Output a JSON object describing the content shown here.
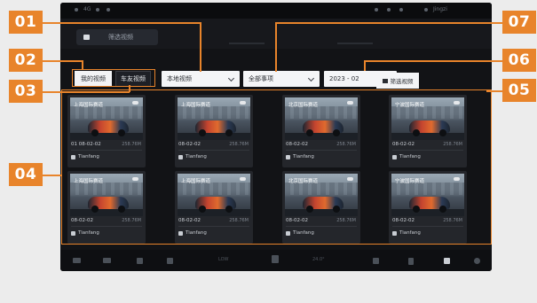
{
  "callouts": {
    "c01": "01",
    "c02": "02",
    "c03": "03",
    "c04": "04",
    "c05": "05",
    "c06": "06",
    "c07": "07"
  },
  "colors": {
    "accent": "#e8842b",
    "screen_bg": "#121316"
  },
  "statusbar": {
    "left_text": "4G",
    "right_user": "Jingzi"
  },
  "topbar": {
    "title": "筛选视频"
  },
  "filters": {
    "all_videos": "我的视频",
    "my_videos": "车友视频",
    "type_select": "本地视频",
    "region_select": "全部事项",
    "date_select": "2023 - 02",
    "filter_button": "筛选视频"
  },
  "cards": [
    {
      "title": "上海国际赛道",
      "time": "01 08-02-02",
      "size": "258.76M",
      "user": "Tianfang"
    },
    {
      "title": "上海国际赛道",
      "time": "08-02-02",
      "size": "258.76M",
      "user": "Tianfang"
    },
    {
      "title": "北京国际赛道",
      "time": "08-02-02",
      "size": "258.76M",
      "user": "Tianfang"
    },
    {
      "title": "宁波国际赛道",
      "time": "08-02-02",
      "size": "258.76M",
      "user": "Tianfang"
    },
    {
      "title": "上海国际赛道",
      "time": "08-02-02",
      "size": "258.76M",
      "user": "Tianfang"
    },
    {
      "title": "上海国际赛道",
      "time": "08-02-02",
      "size": "258.76M",
      "user": "Tianfang"
    },
    {
      "title": "北京国际赛道",
      "time": "08-02-02",
      "size": "258.76M",
      "user": "Tianfang"
    },
    {
      "title": "宁波国际赛道",
      "time": "08-02-02",
      "size": "258.76M",
      "user": "Tianfang"
    }
  ],
  "bottombar": {
    "temp_left": "LOW",
    "temp_right": "24.0°"
  },
  "icons": [
    "car-icon",
    "seat-icon",
    "phone-icon",
    "fan-icon",
    "music-icon",
    "grid-icon",
    "settings-icon",
    "filter-icon",
    "cloud-icon",
    "user-icon"
  ]
}
